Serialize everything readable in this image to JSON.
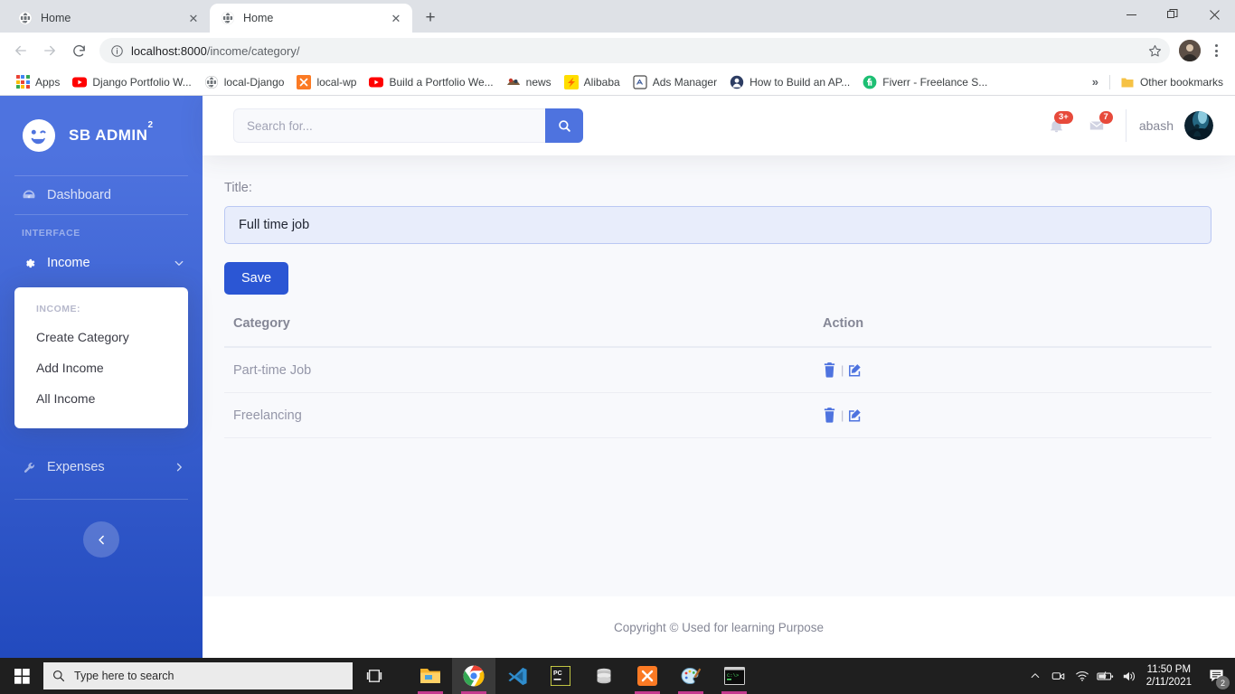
{
  "browser": {
    "tabs": [
      {
        "title": "Home",
        "icon": "globe-icon",
        "active": false
      },
      {
        "title": "Home",
        "icon": "globe-icon",
        "active": true
      }
    ],
    "new_tab_label": "+",
    "window_controls": {
      "minimize": "—",
      "maximize": "❐",
      "close": "✕"
    },
    "nav": {
      "back": "←",
      "forward": "→",
      "reload": "⟳"
    },
    "url": {
      "domain": "localhost:8000",
      "path": "/income/category/",
      "full": "localhost:8000/income/category/"
    },
    "bookmarks": {
      "apps_label": "Apps",
      "items": [
        {
          "label": "Django Portfolio W...",
          "icon": "youtube-icon"
        },
        {
          "label": "local-Django",
          "icon": "globe-icon"
        },
        {
          "label": "local-wp",
          "icon": "xampp-icon"
        },
        {
          "label": "Build a Portfolio We...",
          "icon": "youtube-icon"
        },
        {
          "label": "news",
          "icon": "news-icon"
        },
        {
          "label": "Alibaba",
          "icon": "alibaba-icon"
        },
        {
          "label": "Ads Manager",
          "icon": "ads-icon"
        },
        {
          "label": "How to Build an AP...",
          "icon": "avatar-icon"
        },
        {
          "label": "Fiverr - Freelance S...",
          "icon": "fiverr-icon"
        }
      ],
      "overflow_label": "»",
      "other_bookmarks": "Other bookmarks"
    }
  },
  "sidebar": {
    "brand": {
      "name": "SB ADMIN",
      "sup": "2",
      "icon": "wink-face-icon"
    },
    "dashboard": {
      "label": "Dashboard",
      "icon": "tachometer-icon"
    },
    "heading": "INTERFACE",
    "items": [
      {
        "label": "Income",
        "icon": "cog-icon",
        "caret": "chevron-down-icon",
        "active": true
      },
      {
        "label": "Expenses",
        "icon": "wrench-icon",
        "caret": "chevron-right-icon",
        "active": false
      }
    ],
    "submenu": {
      "header": "INCOME:",
      "items": [
        "Create Category",
        "Add Income",
        "All Income"
      ]
    },
    "collapse_icon": "chevron-left-icon"
  },
  "topbar": {
    "search": {
      "placeholder": "Search for...",
      "value": "",
      "button_icon": "search-icon"
    },
    "alerts": {
      "icon": "bell-icon",
      "badge": "3+"
    },
    "messages": {
      "icon": "envelope-icon",
      "badge": "7"
    },
    "user": {
      "name": "abash",
      "avatar": "user-photo"
    }
  },
  "main": {
    "title_label": "Title:",
    "title_value": "Full time job",
    "title_placeholder": "",
    "save_label": "Save",
    "table": {
      "columns": [
        "Category",
        "Action"
      ],
      "rows": [
        {
          "category": "Part-time Job",
          "actions": [
            "delete-icon",
            "edit-icon"
          ]
        },
        {
          "category": "Freelancing",
          "actions": [
            "delete-icon",
            "edit-icon"
          ]
        }
      ],
      "action_divider": "|"
    }
  },
  "footer": {
    "text": "Copyright © Used for learning Purpose"
  },
  "taskbar": {
    "start_icon": "windows-icon",
    "search_placeholder": "Type here to search",
    "search_icon": "search-icon",
    "taskview_icon": "task-view-icon",
    "apps": [
      {
        "name": "file-explorer-icon",
        "running": true,
        "focused": false
      },
      {
        "name": "chrome-icon",
        "running": true,
        "focused": true
      },
      {
        "name": "vscode-icon",
        "running": false,
        "focused": false
      },
      {
        "name": "pycharm-icon",
        "running": false,
        "focused": false
      },
      {
        "name": "database-icon",
        "running": false,
        "focused": false
      },
      {
        "name": "xampp-icon",
        "running": true,
        "focused": false
      },
      {
        "name": "paint-icon",
        "running": true,
        "focused": false
      },
      {
        "name": "command-prompt-icon",
        "running": true,
        "focused": false
      }
    ],
    "tray": [
      "chevron-up-icon",
      "webcam-icon",
      "wifi-icon",
      "battery-icon",
      "volume-icon"
    ],
    "clock": {
      "time": "11:50 PM",
      "date": "2/11/2021"
    },
    "notifications": {
      "icon": "action-center-icon",
      "count": "2"
    }
  },
  "colors": {
    "brand_primary": "#4e73df",
    "sidebar_gradient_start": "#4e73df",
    "sidebar_gradient_end": "#224abe",
    "content_bg": "#f8f9fc",
    "badge_red": "#e74a3b",
    "muted_text": "#858796",
    "save_button": "#2b56d4"
  }
}
